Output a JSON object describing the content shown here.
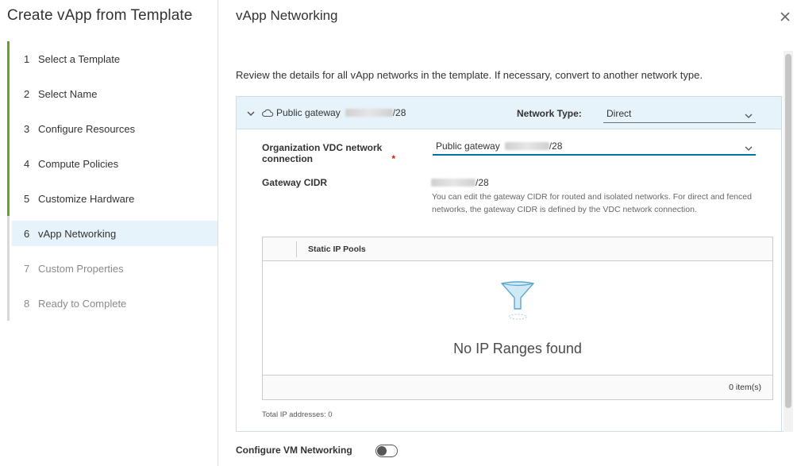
{
  "wizard": {
    "title": "Create vApp from Template",
    "steps": [
      {
        "num": "1",
        "label": "Select a Template",
        "state": "completed"
      },
      {
        "num": "2",
        "label": "Select Name",
        "state": "completed"
      },
      {
        "num": "3",
        "label": "Configure Resources",
        "state": "completed"
      },
      {
        "num": "4",
        "label": "Compute Policies",
        "state": "completed"
      },
      {
        "num": "5",
        "label": "Customize Hardware",
        "state": "completed"
      },
      {
        "num": "6",
        "label": "vApp Networking",
        "state": "current"
      },
      {
        "num": "7",
        "label": "Custom Properties",
        "state": "disabled"
      },
      {
        "num": "8",
        "label": "Ready to Complete",
        "state": "disabled"
      }
    ]
  },
  "page": {
    "title": "vApp Networking",
    "intro": "Review the details for all vApp networks in the template. If necessary, convert to another network type."
  },
  "network": {
    "name_prefix": "Public gateway",
    "name_suffix": "/28",
    "icon": "cloud-icon",
    "network_type_label": "Network Type:",
    "network_type_value": "Direct",
    "org_vdc_label": "Organization VDC network connection",
    "org_vdc_required": "*",
    "org_vdc_prefix": "Public gateway",
    "org_vdc_suffix": "/28",
    "gateway_cidr_label": "Gateway CIDR",
    "gateway_cidr_suffix": "/28",
    "gateway_help": "You can edit the gateway CIDR for routed and isolated networks. For direct and fenced networks, the gateway CIDR is defined by the VDC network connection."
  },
  "ip_pools": {
    "column": "Static IP Pools",
    "empty_message": "No IP Ranges found",
    "count": "0 item(s)",
    "total": "Total IP addresses: 0"
  },
  "vm_networking": {
    "label": "Configure VM Networking",
    "enabled": false
  },
  "colors": {
    "accent": "#0072a3",
    "step_complete": "#62a420",
    "header_bg": "#e6f3fa"
  }
}
